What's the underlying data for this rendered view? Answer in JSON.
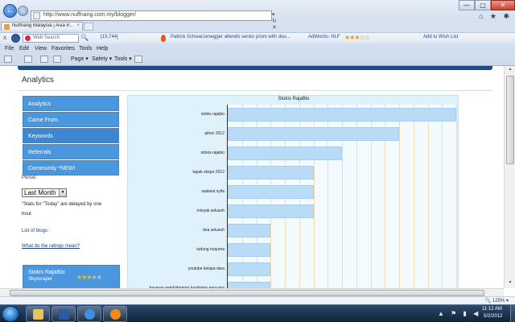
{
  "browser": {
    "url": "http://www.nuffnang.com.my/blogger/",
    "tab_title": "Nuffnang Malaysia | Asia P...",
    "tab_close": "×",
    "back": "←",
    "forward": "→",
    "addr_tools": "▾ ↻ ✕",
    "win_min": "—",
    "win_max": "▢",
    "win_close": "✕",
    "right_icons": "⌂ ★ ✱"
  },
  "toolbar": {
    "close": "x",
    "search_placeholder": "Web Search",
    "search_glass": "🔍",
    "count": "[13,744]",
    "news": "Patrick Schwarzenegger attends senior prom with dou...",
    "adwords": "AdWords- HLF",
    "rating": "★★★☆☆",
    "wish": "Add to Wish List"
  },
  "menu": [
    "File",
    "Edit",
    "View",
    "Favorites",
    "Tools",
    "Help"
  ],
  "commands": [
    "Page ▾",
    "Safety ▾",
    "Tools ▾"
  ],
  "page": {
    "title": "Analytics",
    "sidebar": [
      {
        "label": "Analytics",
        "active": false
      },
      {
        "label": "Came From",
        "active": false
      },
      {
        "label": "Keywords",
        "active": true
      },
      {
        "label": "Referrals",
        "active": false
      },
      {
        "label": "Community *NEW!",
        "active": false
      }
    ],
    "period_label": "Period :",
    "period_value": "Last Month",
    "period_arrow": "▼",
    "stats_note": "\"Stats for \"Today\" are delayed by one hour.",
    "list_of_blogs": "List of blogs :",
    "ratings_link": "What do the ratings mean?",
    "blog": {
      "name": "Stokis RajaBio",
      "type": "Skyscraper",
      "stars_on": "★★★",
      "stars_off": "★★"
    }
  },
  "chart_data": {
    "type": "bar",
    "orientation": "horizontal",
    "title": "Stokis RajaBio",
    "categories": [
      "stokis rajabio",
      "pihec 2012",
      "stokis-rajabio",
      "tapak ekspo 2012",
      "salawat syifa",
      "minyak selusuh",
      "doa selusuh",
      "tudung nurjuma",
      "youtube kelapa dara",
      "bayaran perkhidmatan kesihatan percuma"
    ],
    "values": [
      8,
      6,
      4,
      3,
      3,
      3,
      1.5,
      1.5,
      1.5,
      1.5
    ],
    "xlim": [
      0,
      8
    ],
    "grid": true,
    "legend": "none"
  },
  "status": {
    "zoom": "🔍 125% ▾"
  },
  "taskbar": {
    "tray": "▲ ⚑ ▮ ◀",
    "time": "11:12 AM",
    "date": "5/2/2012"
  }
}
